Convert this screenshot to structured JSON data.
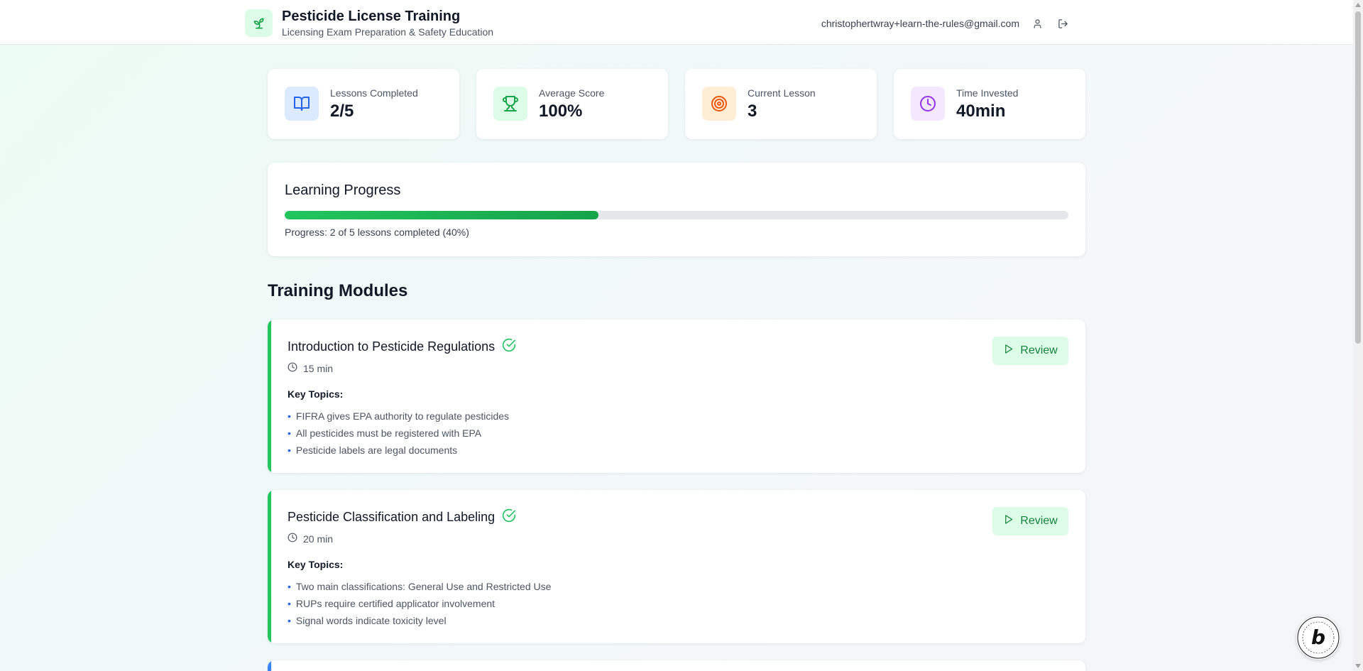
{
  "header": {
    "title": "Pesticide License Training",
    "subtitle": "Licensing Exam Preparation & Safety Education",
    "user_email": "christophertwray+learn-the-rules@gmail.com",
    "brand_icon": "sprout-icon",
    "profile_icon": "user-icon",
    "logout_icon": "logout-icon"
  },
  "stats": [
    {
      "label": "Lessons Completed",
      "value": "2/5",
      "icon": "book-open-icon",
      "bg": "#dbeafe",
      "color": "#2563eb"
    },
    {
      "label": "Average Score",
      "value": "100%",
      "icon": "trophy-icon",
      "bg": "#dcfce7",
      "color": "#16a34a"
    },
    {
      "label": "Current Lesson",
      "value": "3",
      "icon": "target-icon",
      "bg": "#ffedd5",
      "color": "#ea580c"
    },
    {
      "label": "Time Invested",
      "value": "40min",
      "icon": "clock-icon",
      "bg": "#f3e8ff",
      "color": "#9333ea"
    }
  ],
  "progress": {
    "title": "Learning Progress",
    "text": "Progress: 2 of 5 lessons completed (40%)",
    "percent": 40
  },
  "modules_section": {
    "title": "Training Modules",
    "key_topics_label": "Key Topics:",
    "modules": [
      {
        "title": "Introduction to Pesticide Regulations",
        "duration": "15 min",
        "completed": true,
        "button_label": "Review",
        "topics": [
          "FIFRA gives EPA authority to regulate pesticides",
          "All pesticides must be registered with EPA",
          "Pesticide labels are legal documents"
        ]
      },
      {
        "title": "Pesticide Classification and Labeling",
        "duration": "20 min",
        "completed": true,
        "button_label": "Review",
        "topics": [
          "Two main classifications: General Use and Restricted Use",
          "RUPs require certified applicator involvement",
          "Signal words indicate toxicity level"
        ]
      }
    ]
  },
  "colors": {
    "accent_green": "#22c55e",
    "accent_blue": "#3b82f6",
    "bullet_blue": "#2563eb"
  },
  "badge": {
    "icon": "bolt-badge-icon"
  }
}
